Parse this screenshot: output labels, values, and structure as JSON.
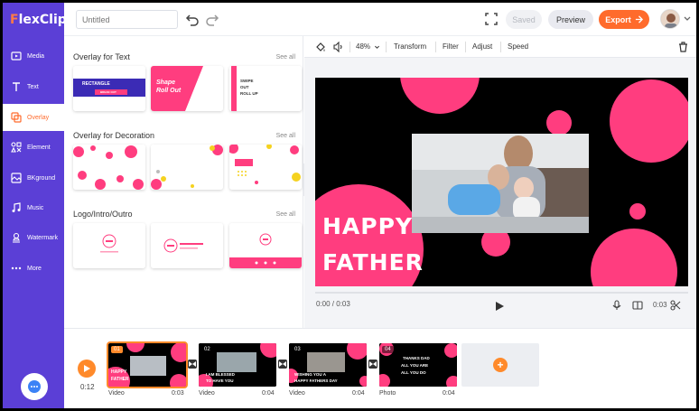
{
  "app": {
    "logo_mark": "F",
    "logo_text": "lexClip"
  },
  "topbar": {
    "title_placeholder": "Untitled",
    "saved_label": "Saved",
    "preview_label": "Preview",
    "export_label": "Export"
  },
  "sidebar": {
    "items": [
      {
        "label": "Media"
      },
      {
        "label": "Text"
      },
      {
        "label": "Overlay"
      },
      {
        "label": "Element"
      },
      {
        "label": "BKground"
      },
      {
        "label": "Music"
      },
      {
        "label": "Watermark"
      },
      {
        "label": "More"
      }
    ]
  },
  "panel": {
    "sections": [
      {
        "title": "Overlay for Text",
        "see_all": "See all"
      },
      {
        "title": "Overlay for Decoration",
        "see_all": "See all"
      },
      {
        "title": "Logo/Intro/Outro",
        "see_all": "See all"
      }
    ],
    "text_thumbs": [
      {
        "line1": "RECTANGLE",
        "line2": "BREAK OUT"
      },
      {
        "line1": "Shape",
        "line2": "Roll Out"
      },
      {
        "line1": "SWIPE",
        "line2": "OUT",
        "line3": "ROLL UP"
      }
    ]
  },
  "toolbar": {
    "zoom": "48%",
    "transform": "Transform",
    "filter": "Filter",
    "adjust": "Adjust",
    "speed": "Speed"
  },
  "canvas": {
    "line1": "HAPPY",
    "line2": "FATHER"
  },
  "player": {
    "time": "0:00 / 0:03",
    "duration": "0:03"
  },
  "timeline": {
    "current_time": "0:12",
    "clips": [
      {
        "num": "01",
        "type": "Video",
        "duration": "0:03",
        "caption1": "HAPPY",
        "caption2": "FATHER"
      },
      {
        "num": "02",
        "type": "Video",
        "duration": "0:04",
        "caption1": "I AM BLESSED",
        "caption2": "TO HAVE YOU"
      },
      {
        "num": "03",
        "type": "Video",
        "duration": "0:04",
        "caption1": "WISHING YOU A",
        "caption2": "HAPPY FATHERS DAY"
      },
      {
        "num": "04",
        "type": "Photo",
        "duration": "0:04",
        "caption1": "THANKS DAD",
        "caption2": "ALL YOU ARE",
        "caption3": "ALL YOU DO"
      }
    ]
  },
  "colors": {
    "brand_purple": "#5b3fd6",
    "accent_orange": "#ff6b2c",
    "pink": "#ff3d7f"
  }
}
